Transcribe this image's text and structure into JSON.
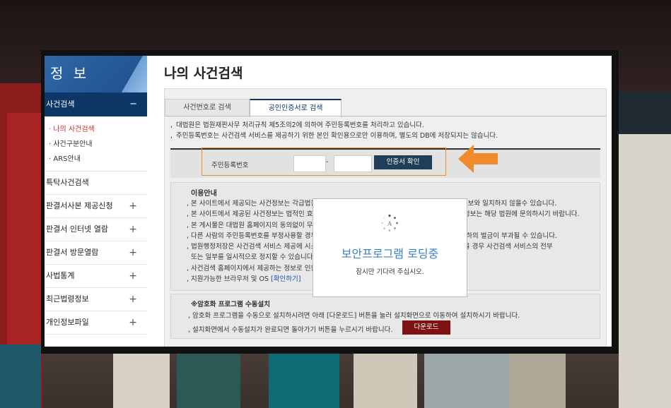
{
  "sidebar": {
    "header": "정 보",
    "active_section": "사건검색",
    "active_toggle": "−",
    "sub_items": [
      "· 나의 사건검색",
      "· 사건구분안내",
      "· ARS안내"
    ],
    "items": [
      {
        "label": "특탁사건검색",
        "toggle": ""
      },
      {
        "label": "판결서사본 제공신청",
        "toggle": "+"
      },
      {
        "label": "판결서 인터넷 열람",
        "toggle": "+"
      },
      {
        "label": "판결서 방문열람",
        "toggle": "+"
      },
      {
        "label": "사법통계",
        "toggle": "+"
      },
      {
        "label": "최근법령정보",
        "toggle": "+"
      },
      {
        "label": "개인정보파일",
        "toggle": "+"
      }
    ]
  },
  "main": {
    "title": "나의 사건검색",
    "tabs": [
      {
        "label": "사건번호로 검색",
        "active": false
      },
      {
        "label": "공인인증서로 검색",
        "active": true
      }
    ],
    "notes": [
      "대법원은 법원재판사무 처리규칙 제5조의2에 의하여 주민등록번호를 처리하고 있습니다.",
      "주민등록번호는 사건검색 서비스를 제공하기 위한 본인 확인용으로만 이용하며, 별도의 DB에 저장되지는 않습니다."
    ],
    "id_row": {
      "label": "주민등록번호",
      "separator": "-",
      "input1_value": "",
      "input2_value": "",
      "cert_button": "인증서 확인"
    },
    "guide": {
      "title": "이용안내",
      "items": [
        "본 사이트에서 제공되는 사건정보는 각급법원의 사건접수 입력사항 및 진행사항에 따라 실제 사건정보와 일치하지 않을수 있습니다.",
        "본 사이트에서 제공된 사건정보는 법적인 효력이 없으니, 참고자료로만 활용하시기 바랍니다. 세부정보는 해당 법원에 문의하시기 바랍니다.",
        "본 게시물은 대법원 홈페이지의 동의없이 무단으로 게재하거나 배포할 수 없습니다.",
        "다른 사람의 주민등록번호를 부정사용할 경우 주민등록법에 의해 3년 이하의 징역 또는 3천만원 이하의 벌금이 부과될 수 있습니다.",
        "법원행정처장은 사건검색 서비스 제공에 시스템 장애 등 정상적인 서비스 제공이 어려운 사정이 있을 경우 사건검색 서비스의 전부",
        "또는 일부를 일시적으로 정지할 수 있습니다.",
        "사건검색 홈페이지에서 제공하는 정보로 인한 손해에 대해서는 책임지지 않습니다.",
        "지원가능한 브라우저 및 OS"
      ],
      "link": "[확인하기]"
    },
    "install": {
      "title": "※암호화 프로그램 수동설치",
      "line1": "암호화 프로그램을 수동으로 설치하시려면 아래 [다운로드] 버튼을 눌러 설치화면으로 이동하여 설치하시기 바랍니다.",
      "line2": "설치화면에서 수동설치가 완료되면 돌아가기 버튼을 누르시기 바랍니다.",
      "download_button": "다운로드"
    }
  },
  "modal": {
    "spinner_letter": "A",
    "title": "보안프로그램 로딩중",
    "subtitle": "잠시만 기다려 주십시오."
  },
  "colors": {
    "nav_active": "#0c3766",
    "highlight_orange": "#f08a2c",
    "download_button": "#7d1212",
    "loading_text": "#3d80c4"
  }
}
